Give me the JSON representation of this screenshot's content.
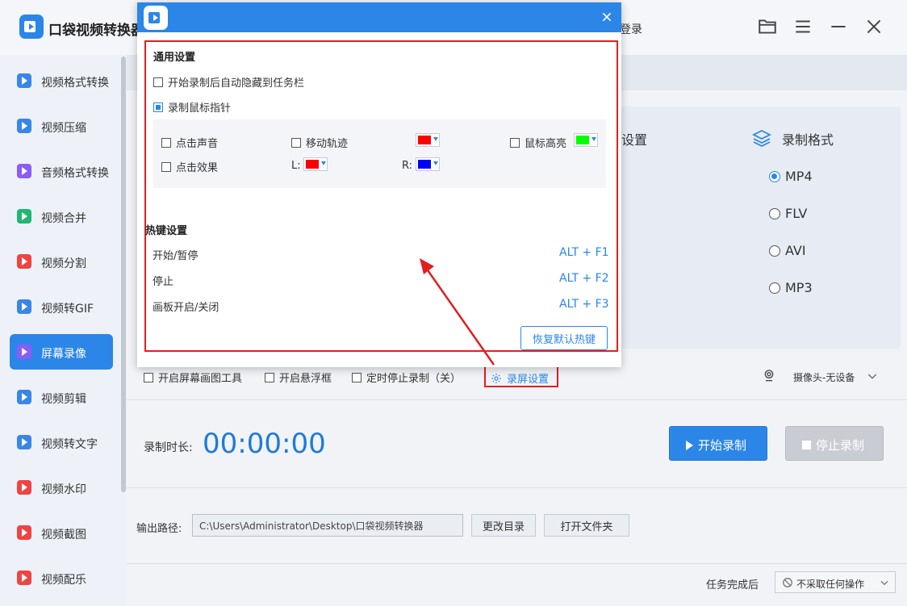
{
  "app": {
    "title": "口袋视频转换器",
    "login": "登录"
  },
  "sidebar": {
    "items": [
      {
        "label": "视频格式转换",
        "color": "#3a86e8",
        "active": false
      },
      {
        "label": "视频压缩",
        "color": "#3a86e8",
        "active": false
      },
      {
        "label": "音频格式转换",
        "color": "#8b5cf6",
        "active": false
      },
      {
        "label": "视频合并",
        "color": "#22b573",
        "active": false
      },
      {
        "label": "视频分割",
        "color": "#ef4444",
        "active": false
      },
      {
        "label": "视频转GIF",
        "color": "#3a86e8",
        "active": false
      },
      {
        "label": "屏幕录像",
        "color": "#8b5cf6",
        "active": true
      },
      {
        "label": "视频剪辑",
        "color": "#3a86e8",
        "active": false
      },
      {
        "label": "视频转文字",
        "color": "#3a86e8",
        "active": false
      },
      {
        "label": "视频水印",
        "color": "#ef4444",
        "active": false
      },
      {
        "label": "视频截图",
        "color": "#ef4444",
        "active": false
      },
      {
        "label": "视频配乐",
        "color": "#ef4444",
        "active": false
      }
    ]
  },
  "main": {
    "mid_panel_title": "设置",
    "format": {
      "title": "录制格式",
      "options": [
        "MP4",
        "FLV",
        "AVI",
        "MP3"
      ],
      "selected": "MP4"
    },
    "options": {
      "draw_tool": "开启屏幕画图工具",
      "float_window": "开启悬浮框",
      "timer_stop": "定时停止录制（关）",
      "rec_settings": "录屏设置"
    },
    "camera": "摄像头-无设备",
    "duration_label": "录制时长:",
    "duration_value": "00:00:00",
    "start_button": "开始录制",
    "stop_button": "停止录制",
    "output_label": "输出路径:",
    "output_path": "C:\\Users\\Administrator\\Desktop\\口袋视频转换器",
    "change_dir": "更改目录",
    "open_folder": "打开文件夹",
    "after_label": "任务完成后",
    "after_value": "不采取任何操作"
  },
  "dialog": {
    "general_title": "通用设置",
    "auto_hide": "开始录制后自动隐藏到任务栏",
    "record_cursor": "录制鼠标指针",
    "click_sound": "点击声音",
    "move_track": "移动轨迹",
    "cursor_highlight": "鼠标高亮",
    "click_effect": "点击效果",
    "l_label": "L:",
    "r_label": "R:",
    "colors": {
      "track": "#ff0000",
      "highlight": "#00ff00",
      "left": "#ff0000",
      "right": "#0000ff"
    },
    "hotkey_title": "热键设置",
    "hotkeys": [
      {
        "name": "开始/暂停",
        "key": "ALT + F1"
      },
      {
        "name": "停止",
        "key": "ALT + F2"
      },
      {
        "name": "画板开启/关闭",
        "key": "ALT + F3"
      }
    ],
    "restore": "恢复默认热键"
  }
}
